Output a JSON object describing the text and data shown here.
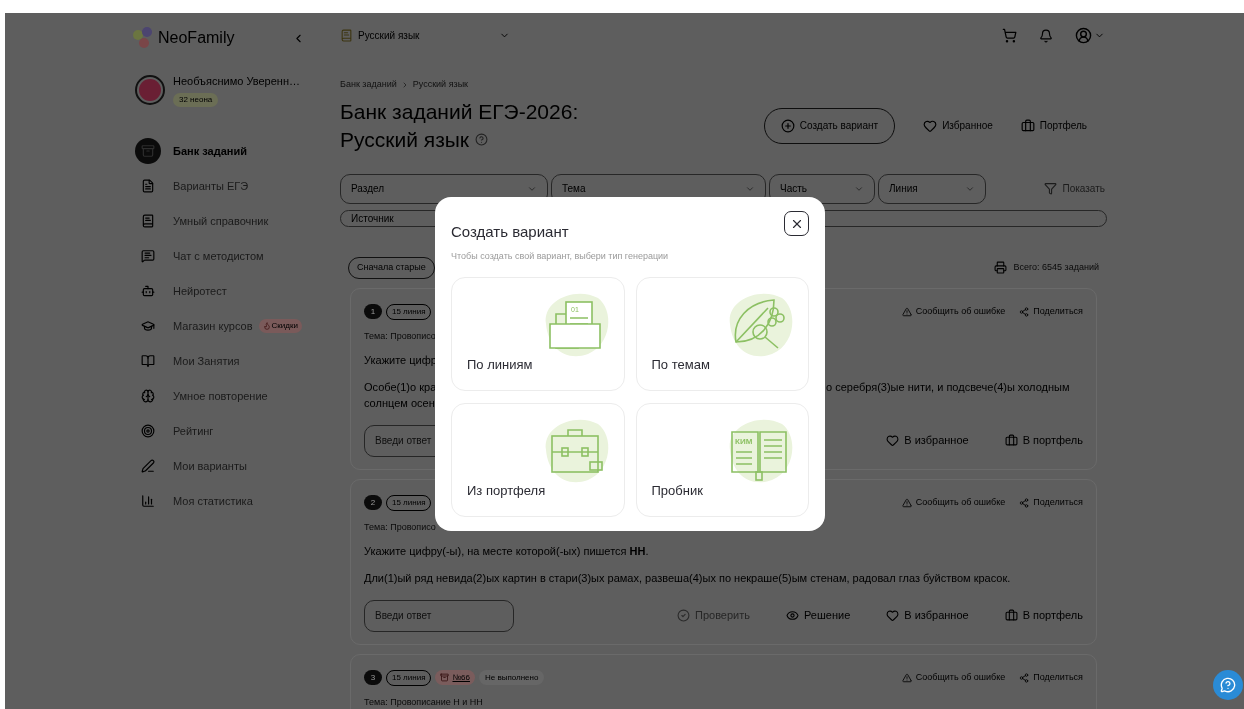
{
  "sidebar": {
    "logo": "NeoFamily",
    "user": {
      "name": "Необъяснимо Уверенн…",
      "balance": "32 неона"
    },
    "items": [
      {
        "label": "Банк заданий",
        "selected": true
      },
      {
        "label": "Варианты ЕГЭ",
        "selected": false
      },
      {
        "label": "Умный справочник",
        "selected": false
      },
      {
        "label": "Чат с методистом",
        "selected": false
      },
      {
        "label": "Нейротест",
        "selected": false
      },
      {
        "label": "Магазин курсов",
        "selected": false,
        "badge": "Скидки"
      },
      {
        "label": "Мои Занятия",
        "selected": false
      },
      {
        "label": "Умное повторение",
        "selected": false
      },
      {
        "label": "Рейтинг",
        "selected": false
      },
      {
        "label": "Мои варианты",
        "selected": false
      },
      {
        "label": "Моя статистика",
        "selected": false
      }
    ]
  },
  "header": {
    "subject": "Русский язык"
  },
  "breadcrumb": [
    "Банк заданий",
    "Русский язык"
  ],
  "title_lines": [
    "Банк заданий ЕГЭ-2026:",
    "Русский язык"
  ],
  "actions": [
    {
      "kind": "create",
      "label": "Создать вариант"
    },
    {
      "kind": "favorite",
      "label": "Избранное"
    },
    {
      "kind": "portfolio",
      "label": "Портфель"
    }
  ],
  "filters": [
    {
      "label": "Раздел"
    },
    {
      "label": "Тема"
    },
    {
      "label": "Часть"
    },
    {
      "label": "Линия"
    }
  ],
  "show_button": "Показать",
  "source_filter": "Источник",
  "sort": "Сначала старые",
  "total": "Всего: 6545 заданий",
  "tasks": [
    {
      "number": "1",
      "line": "15 линия",
      "report": "Сообщить об ошибке",
      "share": "Поделиться",
      "topic": "Тема: Провописо",
      "prompt": "Укажите цифр",
      "text_left": [
        "Особе(1)о кра",
        "солнцем осен"
      ],
      "text_right": "о серебря(3)ые нити, и подсвече(4)ы холодным",
      "answer_placeholder": "Введи ответ",
      "buttons": [
        {
          "kind": "favorite",
          "label": "В избранное"
        },
        {
          "kind": "portfolio",
          "label": "В портфель"
        }
      ]
    },
    {
      "number": "2",
      "line": "15 линия",
      "report": "Сообщить об ошибке",
      "share": "Поделиться",
      "topic": "Тема: Провописо",
      "prompt": "Укажите цифру(-ы), на месте которой(-ых) пишется **НН**.",
      "text": "Дли(1)ый ряд невида(2)ых картин в стари(3)ых рамах, развеша(4)ых по некраше(5)ым стенам, радовал глаз буйством красок.",
      "answer_placeholder": "Введи ответ",
      "buttons": [
        {
          "kind": "check",
          "label": "Проверить",
          "disabled": true
        },
        {
          "kind": "solution",
          "label": "Решение"
        },
        {
          "kind": "favorite",
          "label": "В избранное"
        },
        {
          "kind": "portfolio",
          "label": "В портфель"
        }
      ]
    },
    {
      "number": "3",
      "line": "15 линия",
      "source": "№66",
      "status": "Не выполнено",
      "report": "Сообщить об ошибке",
      "share": "Поделиться",
      "topic": "Тема: Провописание Н и НН"
    }
  ],
  "modal": {
    "title": "Создать вариант",
    "subtitle": "Чтобы создать свой вариант, выбери тип генерации",
    "options": [
      {
        "kind": "lines",
        "label": "По линиям",
        "art_label": "01"
      },
      {
        "kind": "topics",
        "label": "По темам"
      },
      {
        "kind": "portfolio",
        "label": "Из портфеля"
      },
      {
        "kind": "trial",
        "label": "Пробник",
        "art_label": "КИМ"
      }
    ]
  }
}
